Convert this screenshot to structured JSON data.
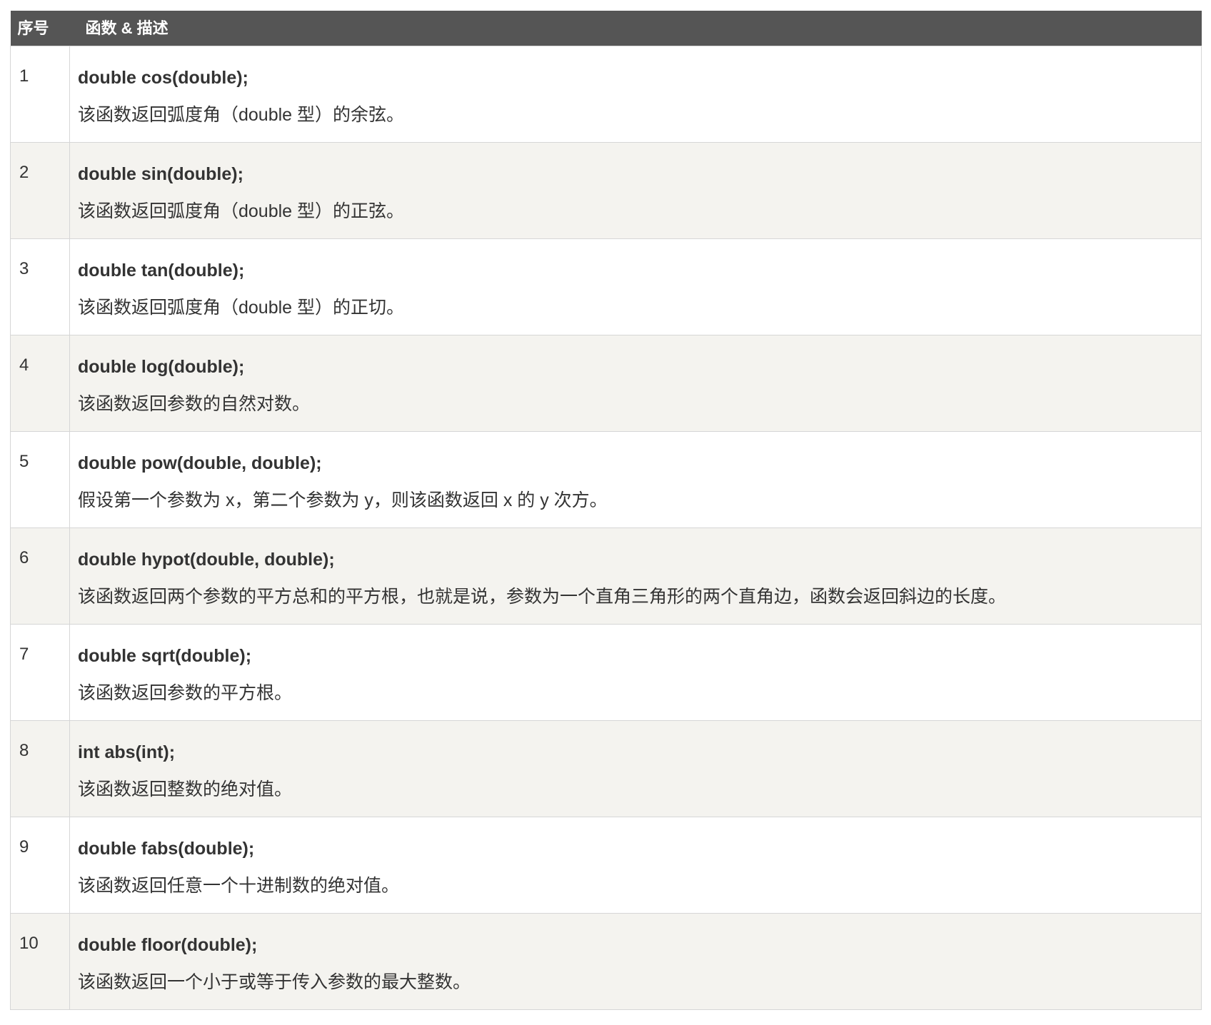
{
  "table": {
    "headers": {
      "index": "序号",
      "description": "函数 & 描述"
    },
    "rows": [
      {
        "num": "1",
        "signature": "double cos(double);",
        "description": "该函数返回弧度角（double 型）的余弦。"
      },
      {
        "num": "2",
        "signature": "double sin(double);",
        "description": "该函数返回弧度角（double 型）的正弦。"
      },
      {
        "num": "3",
        "signature": "double tan(double);",
        "description": "该函数返回弧度角（double 型）的正切。"
      },
      {
        "num": "4",
        "signature": "double log(double);",
        "description": "该函数返回参数的自然对数。"
      },
      {
        "num": "5",
        "signature": "double pow(double, double);",
        "description": "假设第一个参数为 x，第二个参数为 y，则该函数返回 x 的 y 次方。"
      },
      {
        "num": "6",
        "signature": "double hypot(double, double);",
        "description": "该函数返回两个参数的平方总和的平方根，也就是说，参数为一个直角三角形的两个直角边，函数会返回斜边的长度。"
      },
      {
        "num": "7",
        "signature": "double sqrt(double);",
        "description": "该函数返回参数的平方根。"
      },
      {
        "num": "8",
        "signature": "int abs(int);",
        "description": "该函数返回整数的绝对值。"
      },
      {
        "num": "9",
        "signature": "double fabs(double);",
        "description": "该函数返回任意一个十进制数的绝对值。"
      },
      {
        "num": "10",
        "signature": "double floor(double);",
        "description": "该函数返回一个小于或等于传入参数的最大整数。"
      }
    ]
  },
  "colors": {
    "header_bg": "#555555",
    "header_text": "#ffffff",
    "row_alt_bg": "#f4f3ef",
    "border": "#d6d6d6",
    "text": "#333333"
  }
}
